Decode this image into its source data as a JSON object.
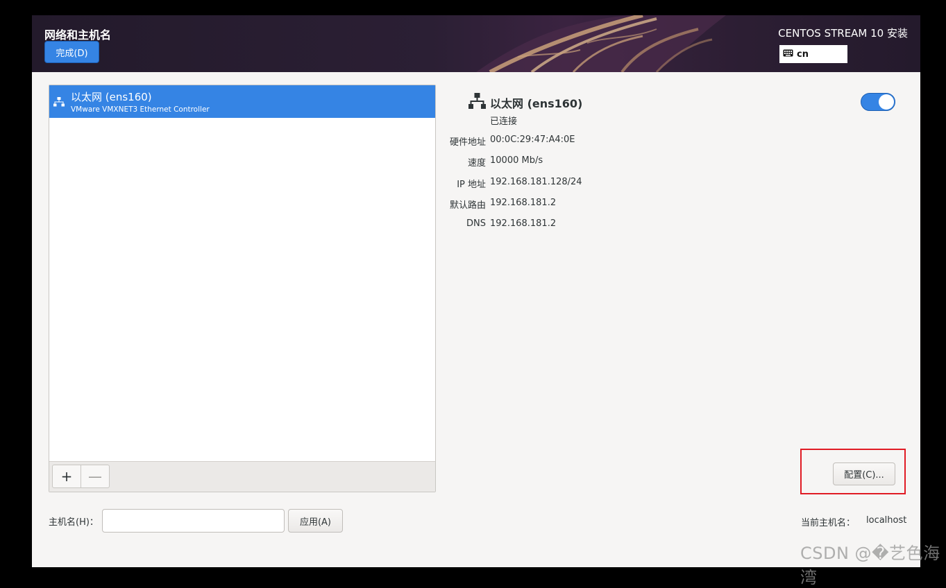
{
  "header": {
    "spoke_title": "网络和主机名",
    "done_label": "完成(D)",
    "product_title": "CENTOS STREAM 10 安装",
    "keyboard_layout": "cn"
  },
  "devices": [
    {
      "name": "以太网 (ens160)",
      "description": "VMware VMXNET3 Ethernet Controller"
    }
  ],
  "list_toolbar": {
    "add_label": "+",
    "remove_label": "—"
  },
  "detail": {
    "title": "以太网 (ens160)",
    "status": "已连接",
    "switch_on": true,
    "properties": [
      {
        "label": "硬件地址",
        "value": "00:0C:29:47:A4:0E"
      },
      {
        "label": "速度",
        "value": "10000 Mb/s"
      },
      {
        "label": "IP 地址",
        "value": "192.168.181.128/24"
      },
      {
        "label": "默认路由",
        "value": "192.168.181.2"
      },
      {
        "label": "DNS",
        "value": "192.168.181.2"
      }
    ],
    "configure_label": "配置(C)..."
  },
  "hostname": {
    "label": "主机名(H)：",
    "input_value": "",
    "apply_label": "应用(A)",
    "current_label": "当前主机名：",
    "current_value": "localhost"
  },
  "watermark": "CSDN @�艺色海湾",
  "colors": {
    "accent": "#3584e4",
    "highlight": "#e01b24",
    "background": "#f6f5f4"
  }
}
